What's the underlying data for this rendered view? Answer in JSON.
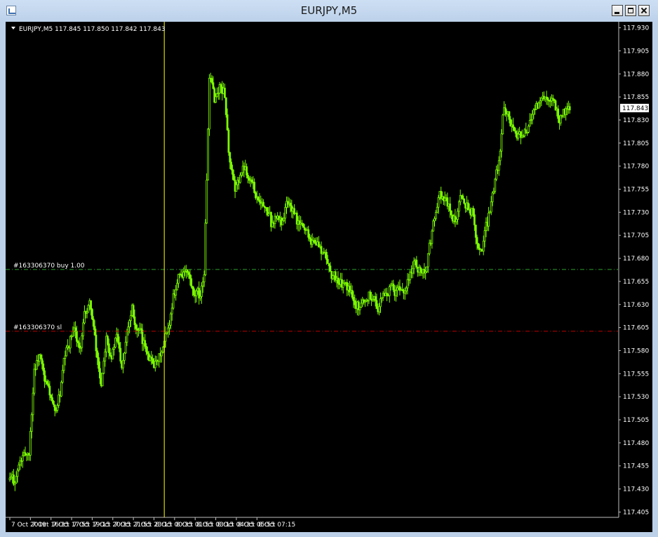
{
  "window": {
    "title": "EURJPY,M5"
  },
  "chart_header": {
    "label": "EURJPY,M5  117.845 117.850 117.842 117.843"
  },
  "colors": {
    "background": "#000000",
    "candle": "#7cfc00",
    "grid": "#808080",
    "crosshair": "#ffff00",
    "buy_line": "#2ca02c",
    "sl_line": "#c00000"
  },
  "chart_data": {
    "type": "candlestick",
    "symbol": "EURJPY",
    "timeframe": "M5",
    "grid": false,
    "ylim": [
      117.4,
      117.935
    ],
    "y_ticks": [
      "117.930",
      "117.905",
      "117.880",
      "117.855",
      "117.830",
      "117.805",
      "117.780",
      "117.755",
      "117.730",
      "117.705",
      "117.680",
      "117.655",
      "117.630",
      "117.605",
      "117.580",
      "117.555",
      "117.530",
      "117.505",
      "117.480",
      "117.455",
      "117.430",
      "117.405"
    ],
    "x_ticks": [
      "7 Oct 2019",
      "7 Oct 16:35",
      "7 Oct 17:55",
      "7 Oct 19:15",
      "7 Oct 20:35",
      "7 Oct 21:55",
      "7 Oct 23:15",
      "8 Oct 00:35",
      "8 Oct 01:55",
      "8 Oct 03:15",
      "8 Oct 04:35",
      "8 Oct 05:55",
      "8 Oct 07:15"
    ],
    "current_price": {
      "value": 117.843,
      "label": "117.843"
    },
    "levels": [
      {
        "label": "#163306370 buy 1.00",
        "price": 117.668,
        "color": "#2ca02c"
      },
      {
        "label": "#163306370 sl",
        "price": 117.601,
        "color": "#c00000"
      }
    ],
    "crosshair_time": "8 Oct 00:55",
    "ohlc_bars_per_tick": 16,
    "close": [
      117.44,
      117.455,
      117.465,
      117.47,
      117.56,
      117.575,
      117.545,
      117.535,
      117.51,
      117.535,
      117.575,
      117.59,
      117.6,
      117.58,
      117.625,
      117.63,
      117.58,
      117.545,
      117.6,
      117.575,
      117.595,
      117.565,
      117.605,
      117.63,
      117.6,
      117.59,
      117.58,
      117.57,
      117.565,
      117.58,
      117.6,
      117.64,
      117.66,
      117.665,
      117.66,
      117.635,
      117.64,
      117.665,
      117.87,
      117.855,
      117.865,
      117.86,
      117.78,
      117.75,
      117.77,
      117.78,
      117.765,
      117.75,
      117.745,
      117.73,
      117.72,
      117.725,
      117.72,
      117.74,
      117.735,
      117.72,
      117.715,
      117.71,
      117.7,
      117.695,
      117.685,
      117.675,
      117.66,
      117.655,
      117.65,
      117.645,
      117.64,
      117.63,
      117.635,
      117.64,
      117.635,
      117.625,
      117.64,
      117.645,
      117.64,
      117.645,
      117.65,
      117.665,
      117.675,
      117.665,
      117.67,
      117.7,
      117.73,
      117.75,
      117.74,
      117.73,
      117.72,
      117.745,
      117.74,
      117.73,
      117.7,
      117.69,
      117.72,
      117.75,
      117.78,
      117.83,
      117.845,
      117.82,
      117.815,
      117.81,
      117.82,
      117.84,
      117.845,
      117.85,
      117.845,
      117.845,
      117.83,
      117.84,
      117.843
    ]
  }
}
